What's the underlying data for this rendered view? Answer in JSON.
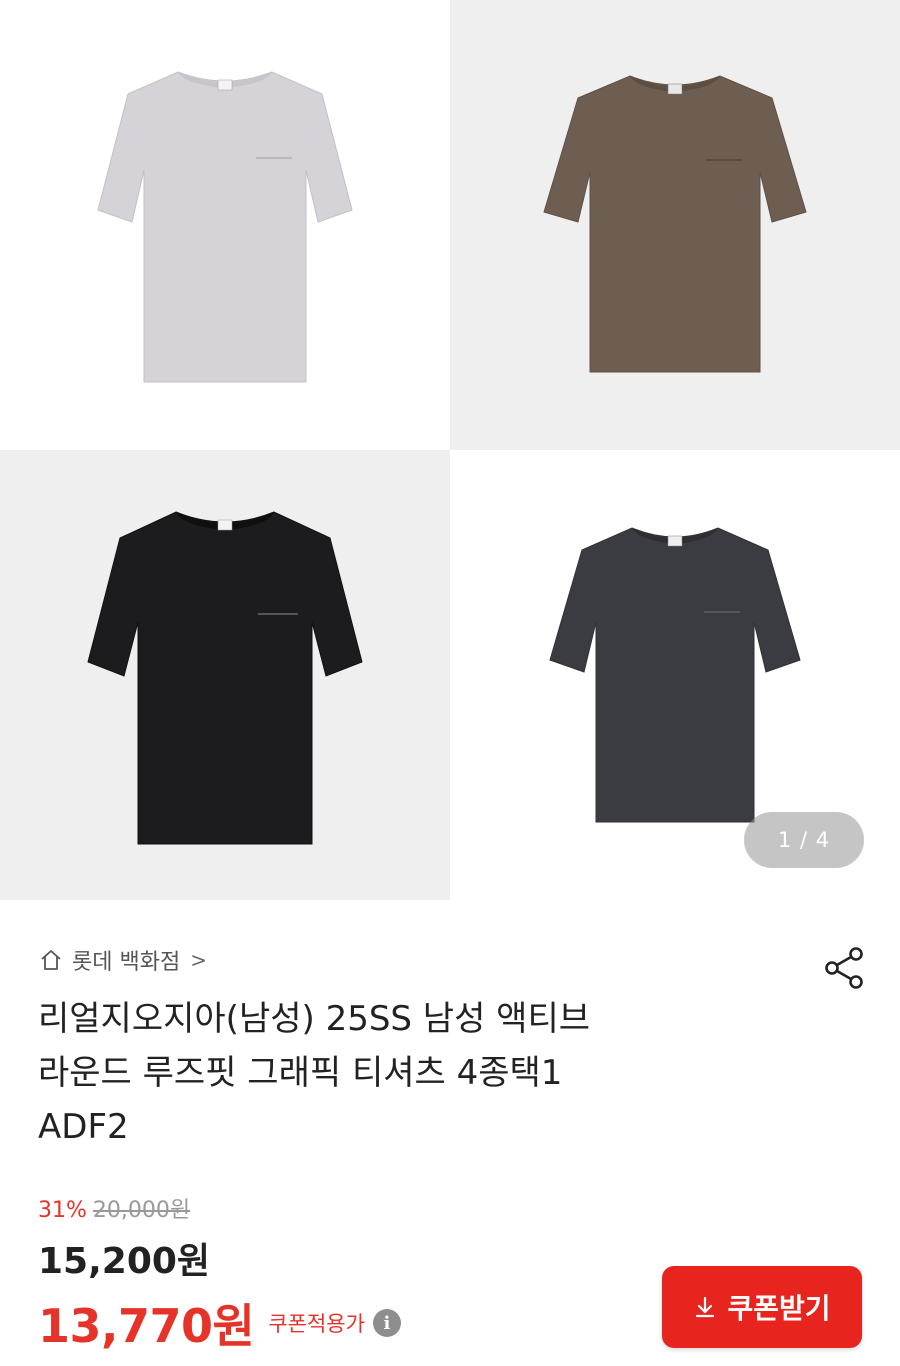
{
  "gallery": {
    "items": [
      {
        "name": "shirt-lavender-grey",
        "color": "#d6d3d8"
      },
      {
        "name": "shirt-brown",
        "color": "#6e5e52"
      },
      {
        "name": "shirt-black",
        "color": "#1c1c1e"
      },
      {
        "name": "shirt-charcoal",
        "color": "#3b3b42"
      }
    ],
    "page_indicator": "1 / 4"
  },
  "store": {
    "name": "롯데 백화점",
    "chevron": ">",
    "icon": "home-icon"
  },
  "share_icon": "share-icon",
  "product": {
    "title_lines": [
      "리얼지오지아(남성) 25SS 남성 액티브",
      "라운드 루즈핏 그래픽 티셔츠 4종택1",
      "ADF2"
    ]
  },
  "price": {
    "discount_rate": "31%",
    "original": "20,000원",
    "sale": "15,200원",
    "coupon_price": "13,770원",
    "coupon_label": "쿠폰적용가",
    "info_icon": "i"
  },
  "coupon_button": {
    "label": "쿠폰받기",
    "icon": "download-icon"
  },
  "colors": {
    "accent": "#e5332a",
    "button": "#e8241e"
  }
}
